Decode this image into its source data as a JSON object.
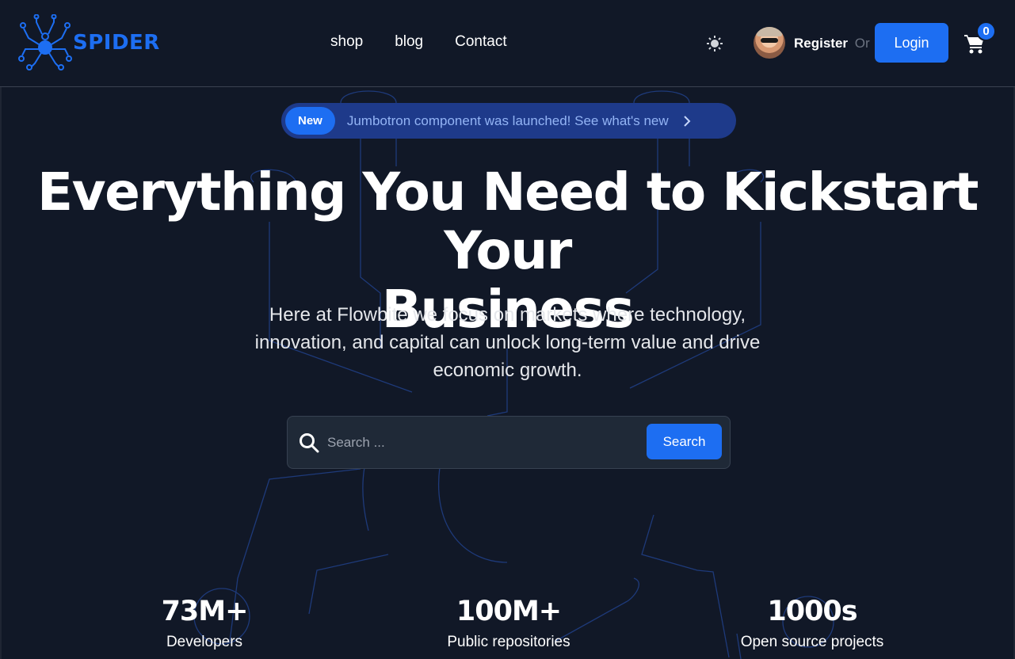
{
  "brand": {
    "name": "SPIDER",
    "accent": "#1d6ef2"
  },
  "nav": {
    "links": [
      "shop",
      "blog",
      "Contact"
    ]
  },
  "header": {
    "theme_icon": "sun-icon",
    "register_label": "Register",
    "or_label": "Or",
    "login_label": "Login",
    "cart_icon": "cart-icon",
    "cart_count": "0"
  },
  "announcement": {
    "badge": "New",
    "text": "Jumbotron component was launched! See what's new"
  },
  "hero": {
    "title_line1": "Everything You Need to Kickstart Your",
    "title_line2": "Business",
    "subtitle": "Here at Flowbite we focus on markets where technology, innovation, and capital can unlock long-term value and drive economic growth."
  },
  "search": {
    "placeholder": "Search ...",
    "button_label": "Search"
  },
  "stats": [
    {
      "value": "73M+",
      "label": "Developers"
    },
    {
      "value": "100M+",
      "label": "Public repositories"
    },
    {
      "value": "1000s",
      "label": "Open source projects"
    }
  ],
  "colors": {
    "background": "#111827",
    "primary": "#1d6ef2",
    "pill_bg": "#1e3a8a"
  }
}
